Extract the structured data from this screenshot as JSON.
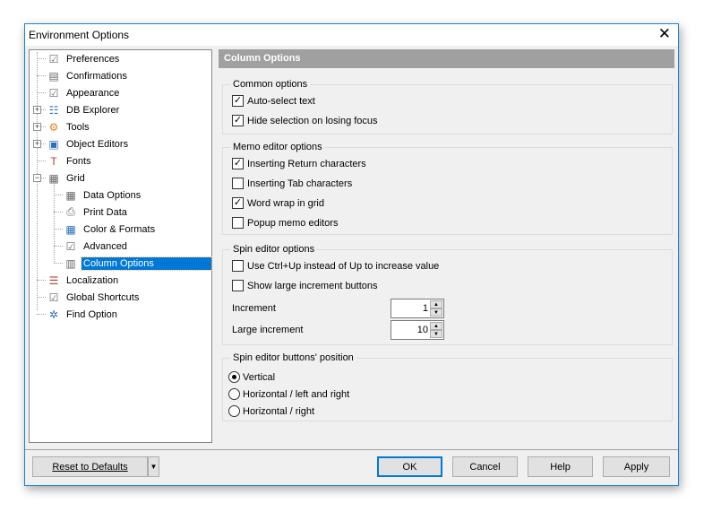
{
  "window": {
    "title": "Environment Options",
    "close_icon": "close-icon"
  },
  "tree": [
    {
      "label": "Preferences",
      "icon": "preferences-icon",
      "level": 0
    },
    {
      "label": "Confirmations",
      "icon": "confirmations-icon",
      "level": 0
    },
    {
      "label": "Appearance",
      "icon": "appearance-icon",
      "level": 0
    },
    {
      "label": "DB Explorer",
      "icon": "db-explorer-icon",
      "level": 0,
      "expander": "+"
    },
    {
      "label": "Tools",
      "icon": "gears-icon",
      "level": 0,
      "expander": "+"
    },
    {
      "label": "Object Editors",
      "icon": "object-editors-icon",
      "level": 0,
      "expander": "+"
    },
    {
      "label": "Fonts",
      "icon": "font-icon",
      "level": 0
    },
    {
      "label": "Grid",
      "icon": "grid-icon",
      "level": 0,
      "expander": "−"
    },
    {
      "label": "Data Options",
      "icon": "grid-data-icon",
      "level": 1
    },
    {
      "label": "Print Data",
      "icon": "printer-icon",
      "level": 1
    },
    {
      "label": "Color & Formats",
      "icon": "color-grid-icon",
      "level": 1
    },
    {
      "label": "Advanced",
      "icon": "advanced-grid-icon",
      "level": 1
    },
    {
      "label": "Column Options",
      "icon": "column-grid-icon",
      "level": 1,
      "selected": true
    },
    {
      "label": "Localization",
      "icon": "localization-icon",
      "level": 0
    },
    {
      "label": "Global Shortcuts",
      "icon": "shortcuts-icon",
      "level": 0
    },
    {
      "label": "Find Option",
      "icon": "find-option-icon",
      "level": 0
    }
  ],
  "panel": {
    "title": "Column Options",
    "common": {
      "legend": "Common options",
      "items": [
        {
          "label": "Auto-select text",
          "checked": true
        },
        {
          "label": "Hide selection on losing focus",
          "checked": true
        }
      ]
    },
    "memo": {
      "legend": "Memo editor options",
      "items": [
        {
          "label": "Inserting Return characters",
          "checked": true
        },
        {
          "label": "Inserting Tab characters",
          "checked": false
        },
        {
          "label": "Word wrap in grid",
          "checked": true
        },
        {
          "label": "Popup memo editors",
          "checked": false
        }
      ]
    },
    "spin": {
      "legend": "Spin editor options",
      "items": [
        {
          "label": "Use Ctrl+Up instead of Up to increase value",
          "checked": false
        },
        {
          "label": "Show large increment buttons",
          "checked": false
        }
      ],
      "increment_label": "Increment",
      "increment": "1",
      "large_increment_label": "Large increment",
      "large_increment": "10"
    },
    "position": {
      "legend": "Spin editor buttons' position",
      "options": [
        {
          "label": "Vertical",
          "selected": true
        },
        {
          "label": "Horizontal / left and right",
          "selected": false
        },
        {
          "label": "Horizontal / right",
          "selected": false
        }
      ]
    }
  },
  "buttons": {
    "reset": "Reset to Defaults",
    "ok": "OK",
    "cancel": "Cancel",
    "help": "Help",
    "apply": "Apply"
  },
  "colors": {
    "accent": "#0078d7",
    "header": "#a0a0a0"
  }
}
